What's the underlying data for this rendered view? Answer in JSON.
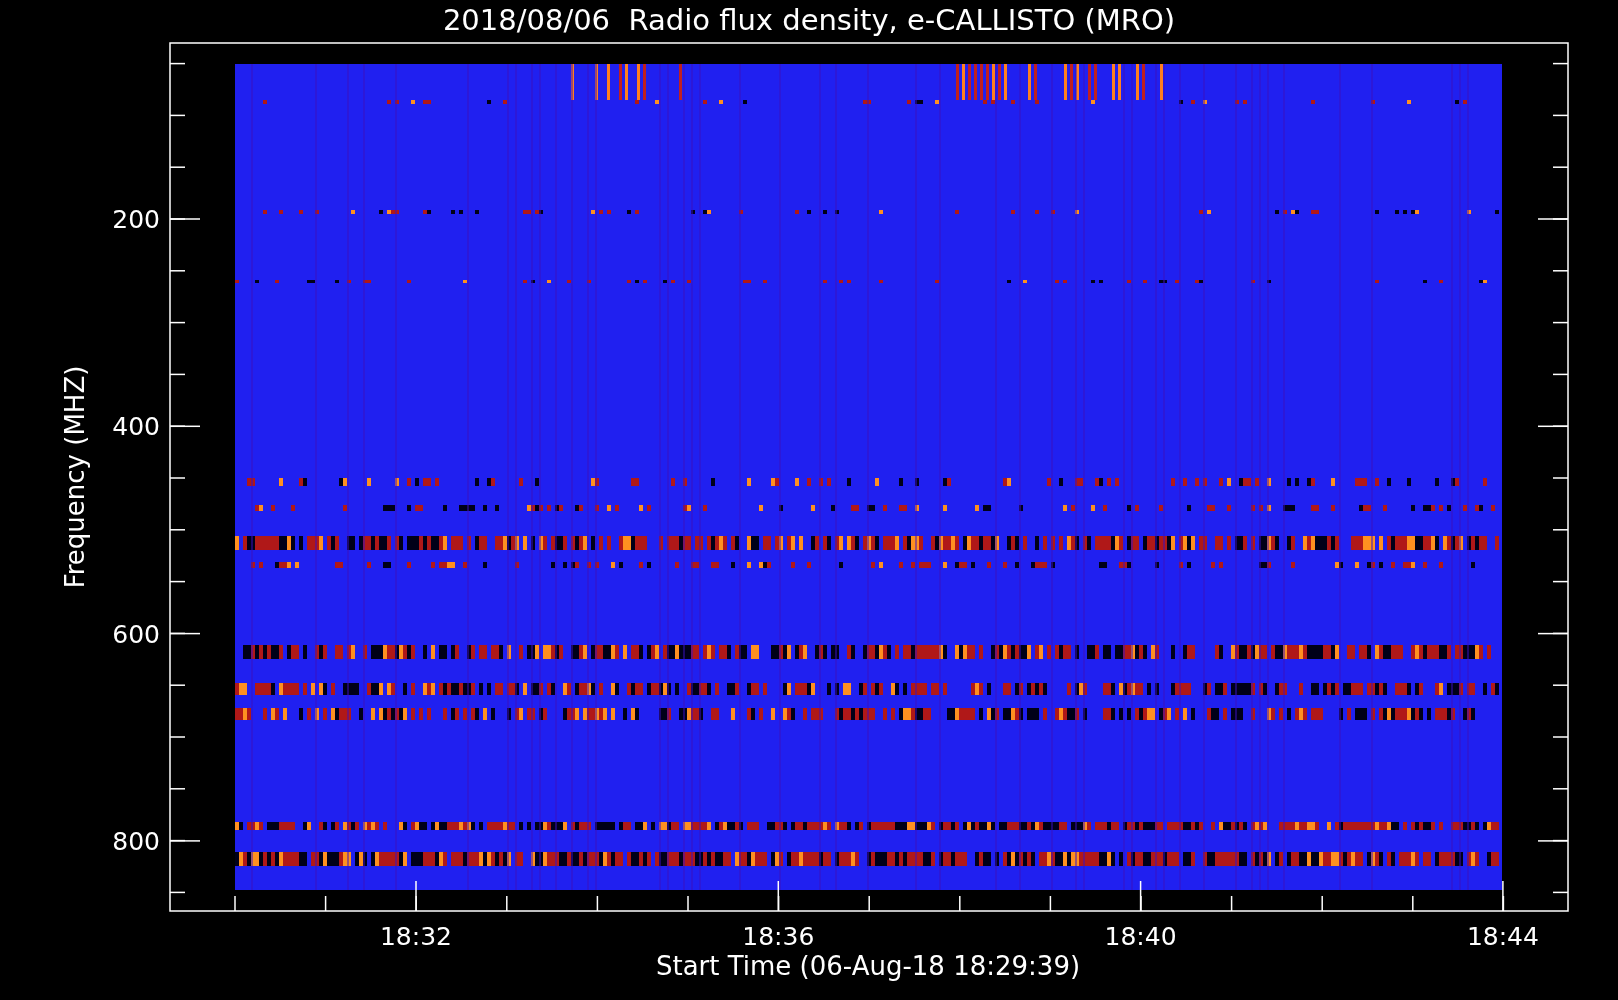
{
  "title": "2018/08/06  Radio flux density, e-CALLISTO (MRO)",
  "y_axis": {
    "label": "Frequency (MHZ)",
    "ticks": [
      "200",
      "400",
      "600",
      "800"
    ]
  },
  "x_axis": {
    "label": "Start Time (06-Aug-18 18:29:39)",
    "ticks": [
      "18:32",
      "18:36",
      "18:40",
      "18:44"
    ]
  }
}
